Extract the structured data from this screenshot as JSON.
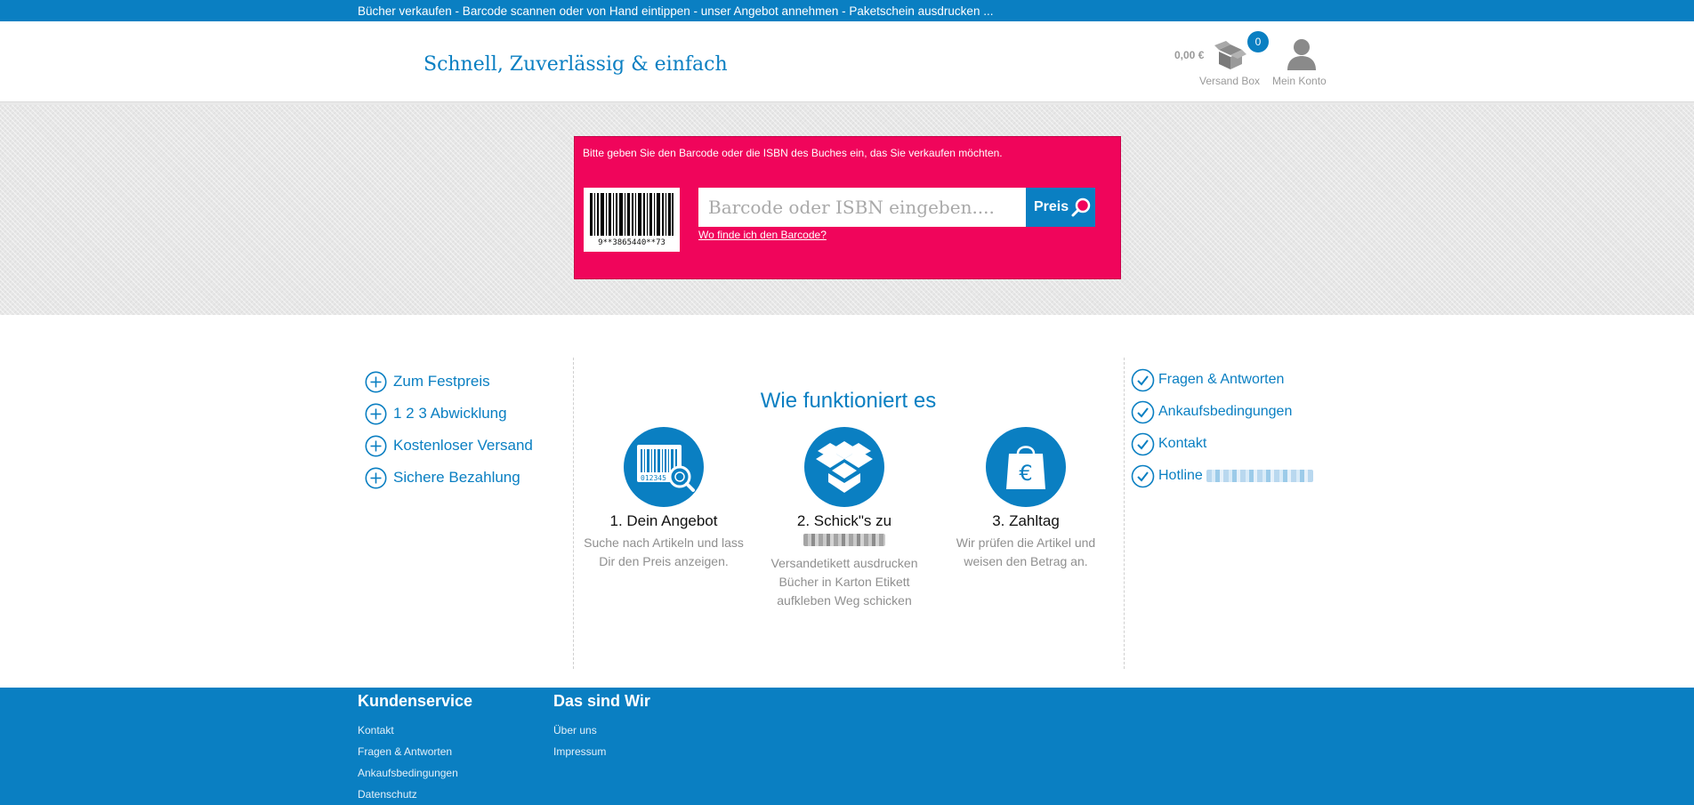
{
  "topbar": {
    "text": "Bücher verkaufen - Barcode scannen oder von Hand eintippen - unser Angebot annehmen - Paketschein ausdrucken ..."
  },
  "header": {
    "tagline": "Schnell, Zuverlässig & einfach",
    "cart_amount": "0,00 €",
    "versand_box_label": "Versand Box",
    "versand_box_count": "0",
    "account_label": "Mein Konto"
  },
  "search": {
    "hint": "Bitte geben Sie den Barcode oder die ISBN des Buches ein, das Sie verkaufen möchten.",
    "barcode_number": "9**3865440**73",
    "placeholder": "Barcode oder ISBN eingeben....",
    "button_label": "Preis",
    "help_link": "Wo finde ich den Barcode?"
  },
  "left_list": {
    "items": [
      "Zum Festpreis",
      "1 2 3 Abwicklung",
      "Kostenloser Versand",
      "Sichere Bezahlung"
    ]
  },
  "how": {
    "title": "Wie funktioniert es",
    "steps": [
      {
        "title": "1. Dein Angebot",
        "text": "Suche nach Artikeln und lass Dir den Preis anzeigen.",
        "icon": "barcode-search-icon"
      },
      {
        "title": "2. Schick\"s zu",
        "text": "Versandetikett ausdrucken Bücher in Karton Etikett aufkleben Weg schicken",
        "icon": "open-box-icon"
      },
      {
        "title": "3. Zahltag",
        "text": "Wir prüfen die Artikel und weisen den Betrag an.",
        "icon": "euro-bag-icon"
      }
    ],
    "barcode_icon_digits": "012345"
  },
  "right_list": {
    "items": [
      "Fragen & Antworten",
      "Ankaufsbedingungen",
      "Kontakt",
      "Hotline"
    ]
  },
  "footer": {
    "kundenservice": {
      "title": "Kundenservice",
      "links": [
        "Kontakt",
        "Fragen & Antworten",
        "Ankaufsbedingungen",
        "Datenschutz"
      ]
    },
    "ueber": {
      "title": "Das sind Wir",
      "links": [
        "Über uns",
        "Impressum"
      ]
    }
  },
  "colors": {
    "brand_blue": "#0a7fc2",
    "search_pink": "#f0055b",
    "muted_gray": "#9a9a9a"
  }
}
